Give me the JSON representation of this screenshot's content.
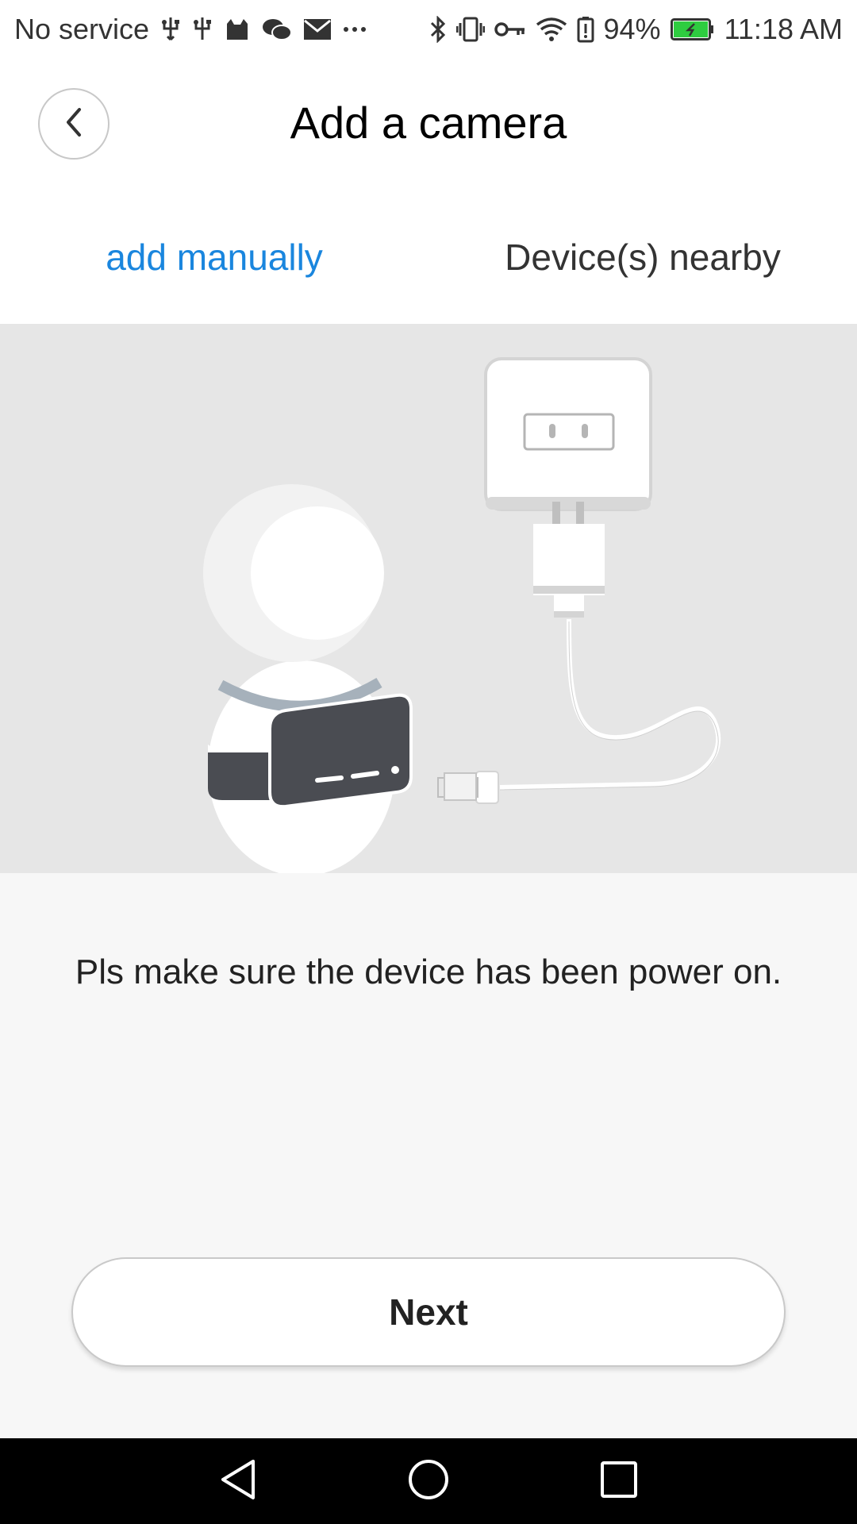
{
  "status_bar": {
    "carrier": "No service",
    "battery_percent": "94%",
    "time": "11:18 AM",
    "left_icons": [
      "usb-icon",
      "usb-icon",
      "cat-icon",
      "wechat-icon",
      "mail-icon",
      "more-icon"
    ],
    "right_icons": [
      "bluetooth-icon",
      "vibrate-icon",
      "key-icon",
      "wifi-icon",
      "battery-alert-icon",
      "battery-icon"
    ],
    "battery_level": 0.94,
    "battery_color": "#2ecc40"
  },
  "header": {
    "title": "Add a camera",
    "back_icon": "chevron-left-icon"
  },
  "tabs": [
    {
      "label": "add manually",
      "active": true
    },
    {
      "label": "Device(s) nearby",
      "active": false
    }
  ],
  "colors": {
    "accent": "#1a86de",
    "illustration_bg": "#e6e6e6",
    "page_bg": "#f7f7f7"
  },
  "message": {
    "text": "Pls make sure the device has been power on."
  },
  "next_button": {
    "label": "Next"
  },
  "nav_bar": {
    "buttons": [
      "back-triangle-icon",
      "home-circle-icon",
      "recents-square-icon"
    ]
  }
}
